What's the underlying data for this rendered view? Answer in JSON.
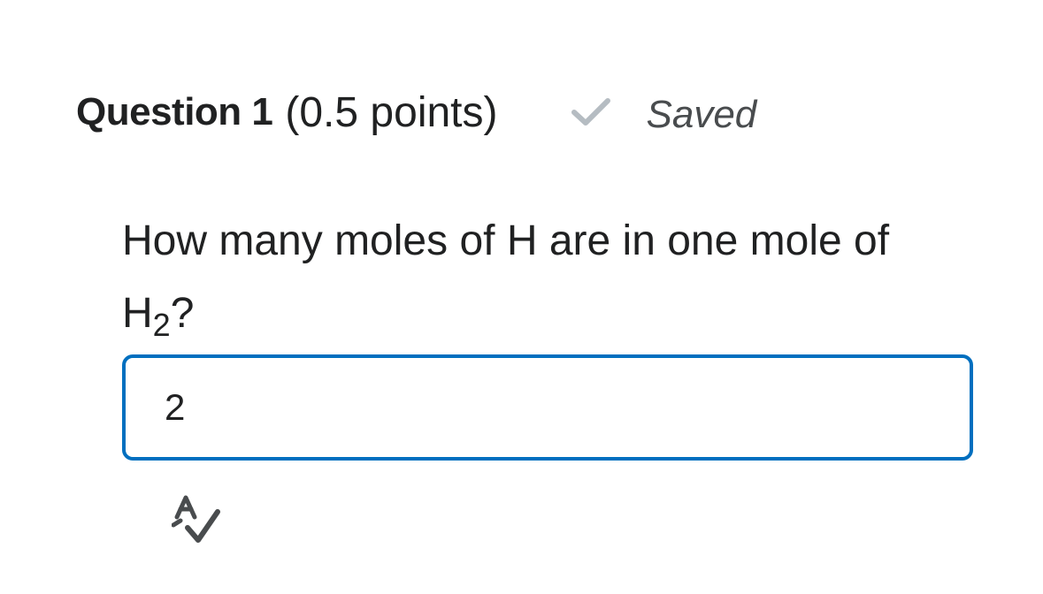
{
  "question": {
    "title": "Question 1",
    "points": "(0.5 points)",
    "status": "Saved",
    "status_icon": "checkmark-icon",
    "text_main": "How many moles of H are in one mole of H",
    "text_subscript": "2",
    "text_end": "?"
  },
  "answer": {
    "value": "2"
  },
  "tools": {
    "spellcheck_icon": "spell-check-icon"
  },
  "colors": {
    "input_border": "#006fbf",
    "check": "#b5bcc2",
    "text": "#202122"
  }
}
